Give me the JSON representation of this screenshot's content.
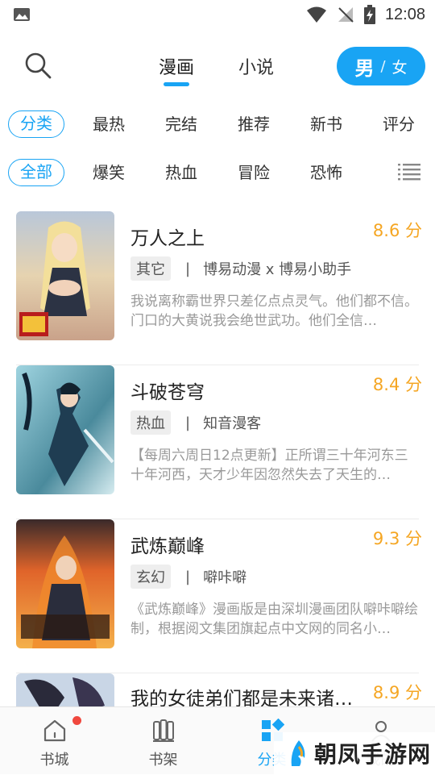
{
  "status_bar": {
    "time": "12:08"
  },
  "header": {
    "tabs": [
      {
        "label": "漫画"
      },
      {
        "label": "小说"
      }
    ],
    "gender": {
      "male": "男",
      "separator": "/",
      "female": "女"
    }
  },
  "filters": {
    "row1": [
      "分类",
      "最热",
      "完结",
      "推荐",
      "新书",
      "评分"
    ],
    "row2": [
      "全部",
      "爆笑",
      "热血",
      "冒险",
      "恐怖"
    ]
  },
  "books": [
    {
      "title": "万人之上",
      "score": "8.6 分",
      "tag": "其它",
      "author": "博易动漫 x 博易小助手",
      "desc": "我说离称霸世界只差亿点点灵气。他们都不信。门口的大黄说我会绝世武功。他们全信…"
    },
    {
      "title": "斗破苍穹",
      "score": "8.4 分",
      "tag": "热血",
      "author": "知音漫客",
      "desc": "【每周六周日12点更新】正所谓三十年河东三十年河西，天才少年因忽然失去了天生的…"
    },
    {
      "title": "武炼巅峰",
      "score": "9.3 分",
      "tag": "玄幻",
      "author": "噼咔噼",
      "desc": "《武炼巅峰》漫画版是由深圳漫画团队噼咔噼绘制，根据阅文集团旗起点中文网的同名小…"
    },
    {
      "title": "我的女徒弟们都是未来诸…",
      "score": "8.9 分",
      "tag": "",
      "author": "",
      "desc": ""
    }
  ],
  "bottom_nav": [
    {
      "label": "书城",
      "icon": "home-icon"
    },
    {
      "label": "书架",
      "icon": "bookshelf-icon"
    },
    {
      "label": "分类",
      "icon": "category-grid-icon"
    },
    {
      "label": "我的",
      "icon": "profile-icon"
    }
  ],
  "watermark": {
    "text": "朝凤手游网"
  },
  "colors": {
    "accent": "#19a4f4",
    "score": "#f5a623",
    "badge": "#f0483e"
  }
}
